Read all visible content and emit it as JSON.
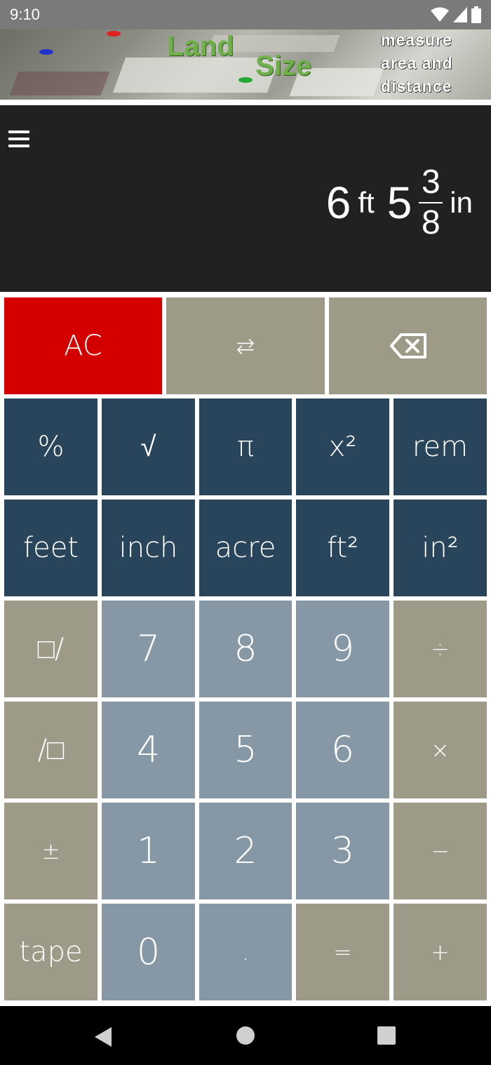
{
  "status_bar": {
    "time": "9:10",
    "icons": [
      "wifi-icon",
      "signal-icon",
      "battery-icon"
    ]
  },
  "banner": {
    "word1": "Land",
    "word2": "Size",
    "tagline": [
      "measure",
      "area and",
      "distance"
    ]
  },
  "display": {
    "menu_icon": "hamburger-menu-icon",
    "feet_value": "6",
    "feet_unit": "ft",
    "inch_whole": "5",
    "inch_numerator": "3",
    "inch_denominator": "8",
    "inch_unit": "in"
  },
  "keys": {
    "clear": "AC",
    "swap": "⇆",
    "backspace_icon": "backspace-icon",
    "percent": "%",
    "sqrt": "√",
    "pi": "π",
    "square": "x²",
    "rem": "rem",
    "feet": "feet",
    "inch": "inch",
    "acre": "acre",
    "sqft": "ft²",
    "sqin": "in²",
    "frac_num": "□/",
    "frac_den": "/□",
    "plusminus": "±",
    "tape": "tape",
    "d7": "7",
    "d8": "8",
    "d9": "9",
    "d4": "4",
    "d5": "5",
    "d6": "6",
    "d1": "1",
    "d2": "2",
    "d3": "3",
    "d0": "0",
    "dot": ".",
    "divide": "÷",
    "multiply": "×",
    "minus": "−",
    "equals": "=",
    "plus": "+"
  },
  "colors": {
    "clear_key": "#d40000",
    "tan_key": "#9e9a88",
    "navy_key": "#29455c",
    "steel_key": "#8698a6",
    "display_bg": "#212121"
  },
  "nav_bar": {
    "icons": [
      "back-icon",
      "home-icon",
      "recents-icon"
    ]
  }
}
